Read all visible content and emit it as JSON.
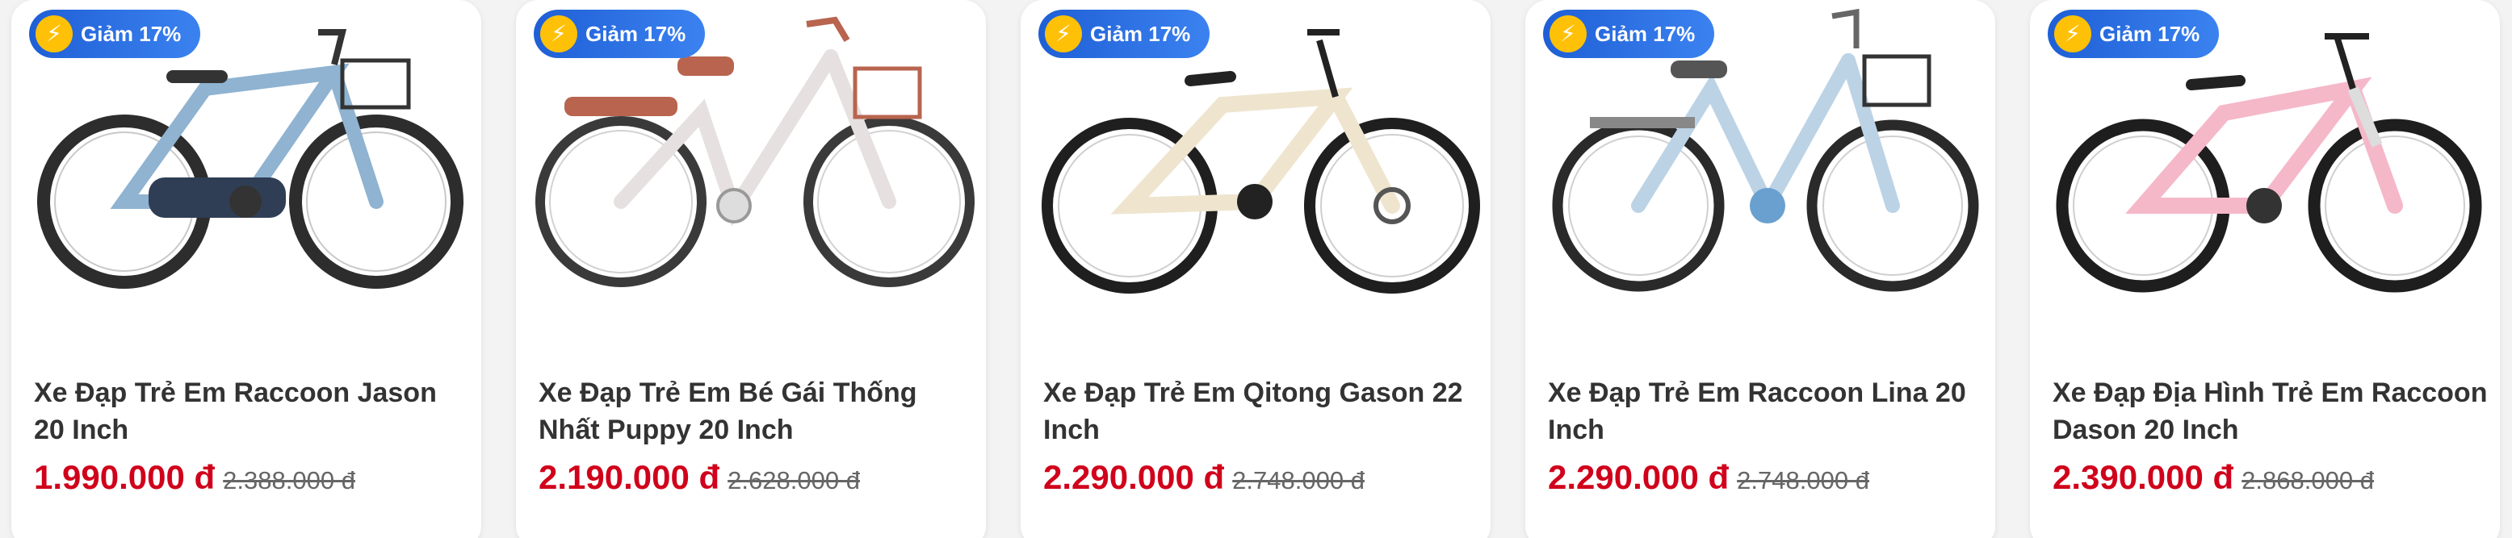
{
  "products": [
    {
      "badge": "Giảm 17%",
      "name": "Xe Đạp Trẻ Em Raccoon Jason 20 Inch",
      "price": "1.990.000 đ",
      "old_price": "2.388.000 đ",
      "frame_color": "#8fb3d1",
      "accent_color": "#6e93b6"
    },
    {
      "badge": "Giảm 17%",
      "name": "Xe Đạp Trẻ Em Bé Gái Thống Nhất Puppy 20 Inch",
      "price": "2.190.000 đ",
      "old_price": "2.628.000 đ",
      "frame_color": "#f6f3f3",
      "accent_color": "#b8644f"
    },
    {
      "badge": "Giảm 17%",
      "name": "Xe Đạp Trẻ Em Qitong Gason 22 Inch",
      "price": "2.290.000 đ",
      "old_price": "2.748.000 đ",
      "frame_color": "#efe5cf",
      "accent_color": "#2b2b2b"
    },
    {
      "badge": "Giảm 17%",
      "name": "Xe Đạp Trẻ Em Raccoon Lina 20 Inch",
      "price": "2.290.000 đ",
      "old_price": "2.748.000 đ",
      "frame_color": "#bcd3e6",
      "accent_color": "#555555"
    },
    {
      "badge": "Giảm 17%",
      "name": "Xe Đạp Địa Hình Trẻ Em Raccoon Dason 20 Inch",
      "price": "2.390.000 đ",
      "old_price": "2.868.000 đ",
      "frame_color": "#f5b8c9",
      "accent_color": "#333333"
    }
  ],
  "colors": {
    "price": "#d0021b",
    "badge_start": "#1f5fd6",
    "badge_end": "#3b82f0",
    "bolt": "#ffc107"
  },
  "icons": {
    "badge_icon": "lightning-bolt-icon"
  }
}
